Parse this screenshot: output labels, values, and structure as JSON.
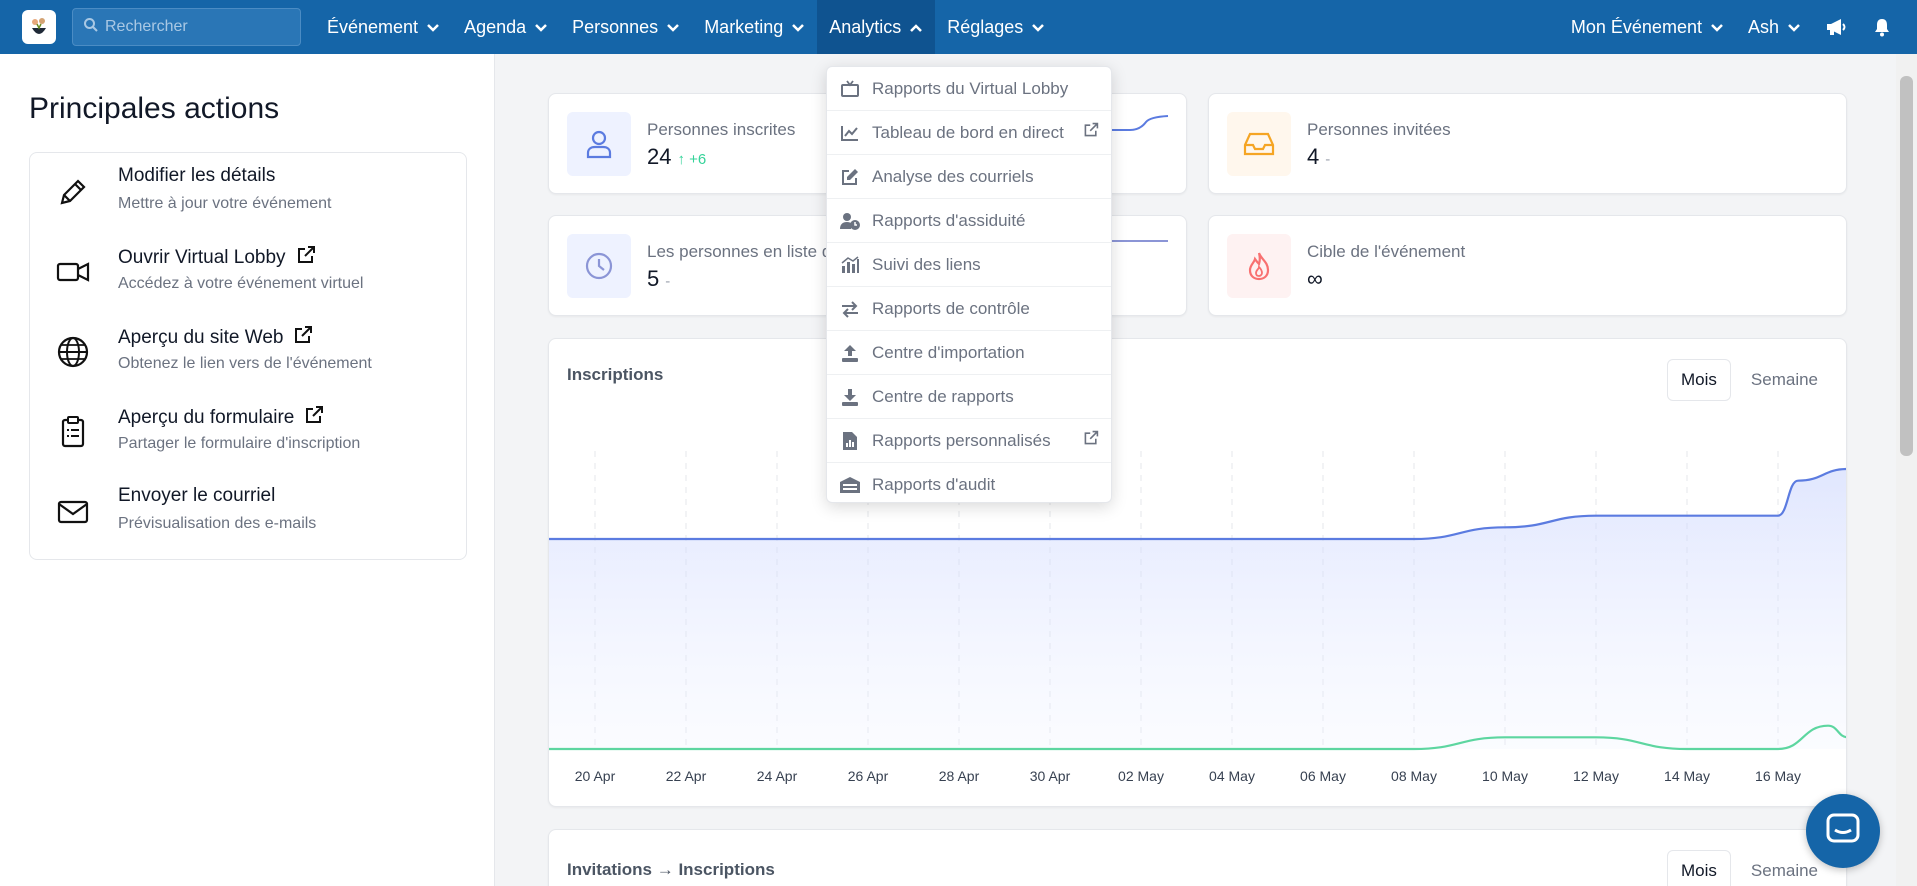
{
  "nav": {
    "search_placeholder": "Rechercher",
    "items": [
      {
        "label": "Événement"
      },
      {
        "label": "Agenda"
      },
      {
        "label": "Personnes"
      },
      {
        "label": "Marketing"
      },
      {
        "label": "Analytics"
      },
      {
        "label": "Réglages"
      }
    ],
    "right": {
      "event": "Mon Événement",
      "user": "Ash"
    }
  },
  "left": {
    "title": "Principales actions",
    "actions": [
      {
        "title": "Modifier les détails",
        "sub": "Mettre à jour votre événement"
      },
      {
        "title": "Ouvrir Virtual Lobby",
        "sub": "Accédez à votre événement virtuel"
      },
      {
        "title": "Aperçu du site Web",
        "sub": "Obtenez le lien vers de l'événement"
      },
      {
        "title": "Aperçu du formulaire",
        "sub": "Partager le formulaire d'inscription"
      },
      {
        "title": "Envoyer le courriel",
        "sub": "Prévisualisation des e-mails"
      }
    ]
  },
  "stats": {
    "registered": {
      "label": "Personnes inscrites",
      "value": "24",
      "delta": "+6"
    },
    "invited": {
      "label": "Personnes invitées",
      "value": "4",
      "delta": "-"
    },
    "waitlist": {
      "label": "Les personnes en liste d'attente",
      "value": "5",
      "delta": "-"
    },
    "target": {
      "label": "Cible de l'événement",
      "value": "∞"
    }
  },
  "chart1": {
    "title": "Inscriptions",
    "toggle": {
      "month": "Mois",
      "week": "Semaine"
    }
  },
  "chart2": {
    "title": "Invitations → Inscriptions",
    "toggle": {
      "month": "Mois",
      "week": "Semaine"
    }
  },
  "chart_data": {
    "type": "area",
    "title": "Inscriptions",
    "x": [
      "20 Apr",
      "22 Apr",
      "24 Apr",
      "26 Apr",
      "28 Apr",
      "30 Apr",
      "02 May",
      "04 May",
      "06 May",
      "08 May",
      "10 May",
      "12 May",
      "14 May",
      "16 May"
    ],
    "series": [
      {
        "color": "#5b7be0",
        "values": [
          18,
          18,
          18,
          18,
          18,
          18,
          18,
          18,
          18,
          18,
          19,
          20,
          20,
          20
        ]
      },
      {
        "color": "#5dd6a0",
        "values": [
          0,
          0,
          0,
          0,
          0,
          0,
          0,
          0,
          0,
          0,
          1,
          1,
          0,
          0
        ]
      }
    ],
    "grid": "vertical dashed",
    "legend": "none"
  },
  "dropdown": {
    "items": [
      {
        "label": "Rapports du Virtual Lobby",
        "icon": "tv-icon",
        "external": false
      },
      {
        "label": "Tableau de bord en direct",
        "icon": "chart-line-icon",
        "external": true
      },
      {
        "label": "Analyse des courriels",
        "icon": "edit-icon",
        "external": false
      },
      {
        "label": "Rapports d'assiduité",
        "icon": "user-clock-icon",
        "external": false
      },
      {
        "label": "Suivi des liens",
        "icon": "bar-chart-icon",
        "external": false
      },
      {
        "label": "Rapports de contrôle",
        "icon": "exchange-icon",
        "external": false
      },
      {
        "label": "Centre d'importation",
        "icon": "upload-icon",
        "external": false
      },
      {
        "label": "Centre de rapports",
        "icon": "download-icon",
        "external": false
      },
      {
        "label": "Rapports personnalisés",
        "icon": "file-chart-icon",
        "external": true
      },
      {
        "label": "Rapports d'audit",
        "icon": "archive-icon",
        "external": false
      }
    ]
  },
  "colors": {
    "nav": "#1565a8",
    "accent": "#5b7be0",
    "green": "#34d399"
  }
}
